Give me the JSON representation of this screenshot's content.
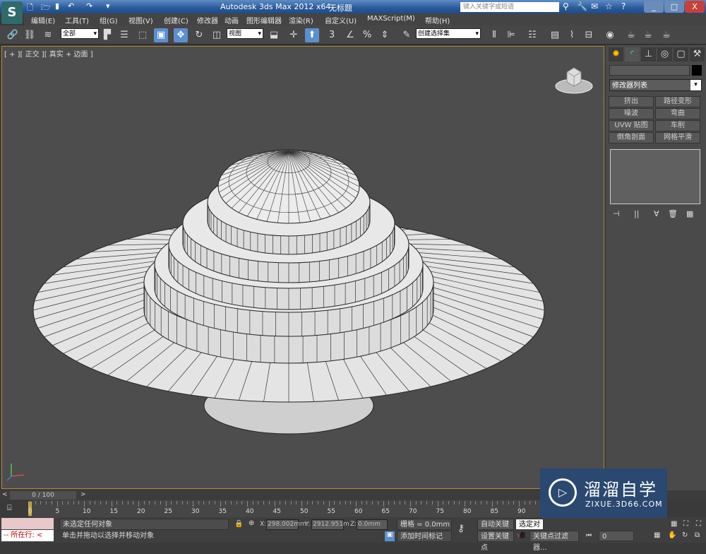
{
  "titlebar": {
    "app_title": "Autodesk 3ds Max  2012 x64",
    "doc_title": "无标题",
    "search_placeholder": "键入关键字或短语"
  },
  "menu": [
    "编辑(E)",
    "工具(T)",
    "组(G)",
    "视图(V)",
    "创建(C)",
    "修改器",
    "动画",
    "图形编辑器",
    "渲染(R)",
    "自定义(U)",
    "MAXScript(M)",
    "帮助(H)"
  ],
  "toolbar": {
    "selection_filter": "全部",
    "reference_coord": "视图",
    "snap_angle_label": "3",
    "named_selection": "创建选择集"
  },
  "viewport": {
    "label": "[ + ][ 正交 ][ 真实 + 边面 ]",
    "background": "#4d4d4d"
  },
  "command_panel": {
    "modifier_list": "修改器列表",
    "modifier_buttons": [
      "挤出",
      "路径变形",
      "噪波",
      "弯曲",
      "UVW 贴图",
      "车削",
      "倒角剖面",
      "网格平滑"
    ]
  },
  "timeline": {
    "frame_display": "0 / 100",
    "ticks": [
      "0",
      "5",
      "10",
      "15",
      "20",
      "25",
      "30",
      "35",
      "40",
      "45",
      "50",
      "55",
      "60",
      "65",
      "70",
      "75",
      "80",
      "85",
      "90"
    ]
  },
  "status": {
    "maxscript_line": "-- 所在行: <",
    "selection": "未选定任何对象",
    "prompt": "单击并拖动以选择并移动对象",
    "x_label": "X:",
    "x_value": "298.002mm",
    "y_label": "Y:",
    "y_value": "2912.951m",
    "z_label": "Z:",
    "z_value": "0.0mm",
    "grid": "栅格 = 0.0mm",
    "add_time_tag": "添加时间标记",
    "auto_key": "自动关键点",
    "set_key": "设置关键点",
    "selected_dropdown": "选定对象",
    "key_filters": "关键点过滤器...",
    "current_frame": "0"
  },
  "watermark": {
    "brand": "溜溜自学",
    "url": "ZIXUE.3D66.COM"
  },
  "colors": {
    "accent": "#5b8fd0",
    "titlebar": "#2a5a9a",
    "viewport_border": "#b08a3a"
  }
}
